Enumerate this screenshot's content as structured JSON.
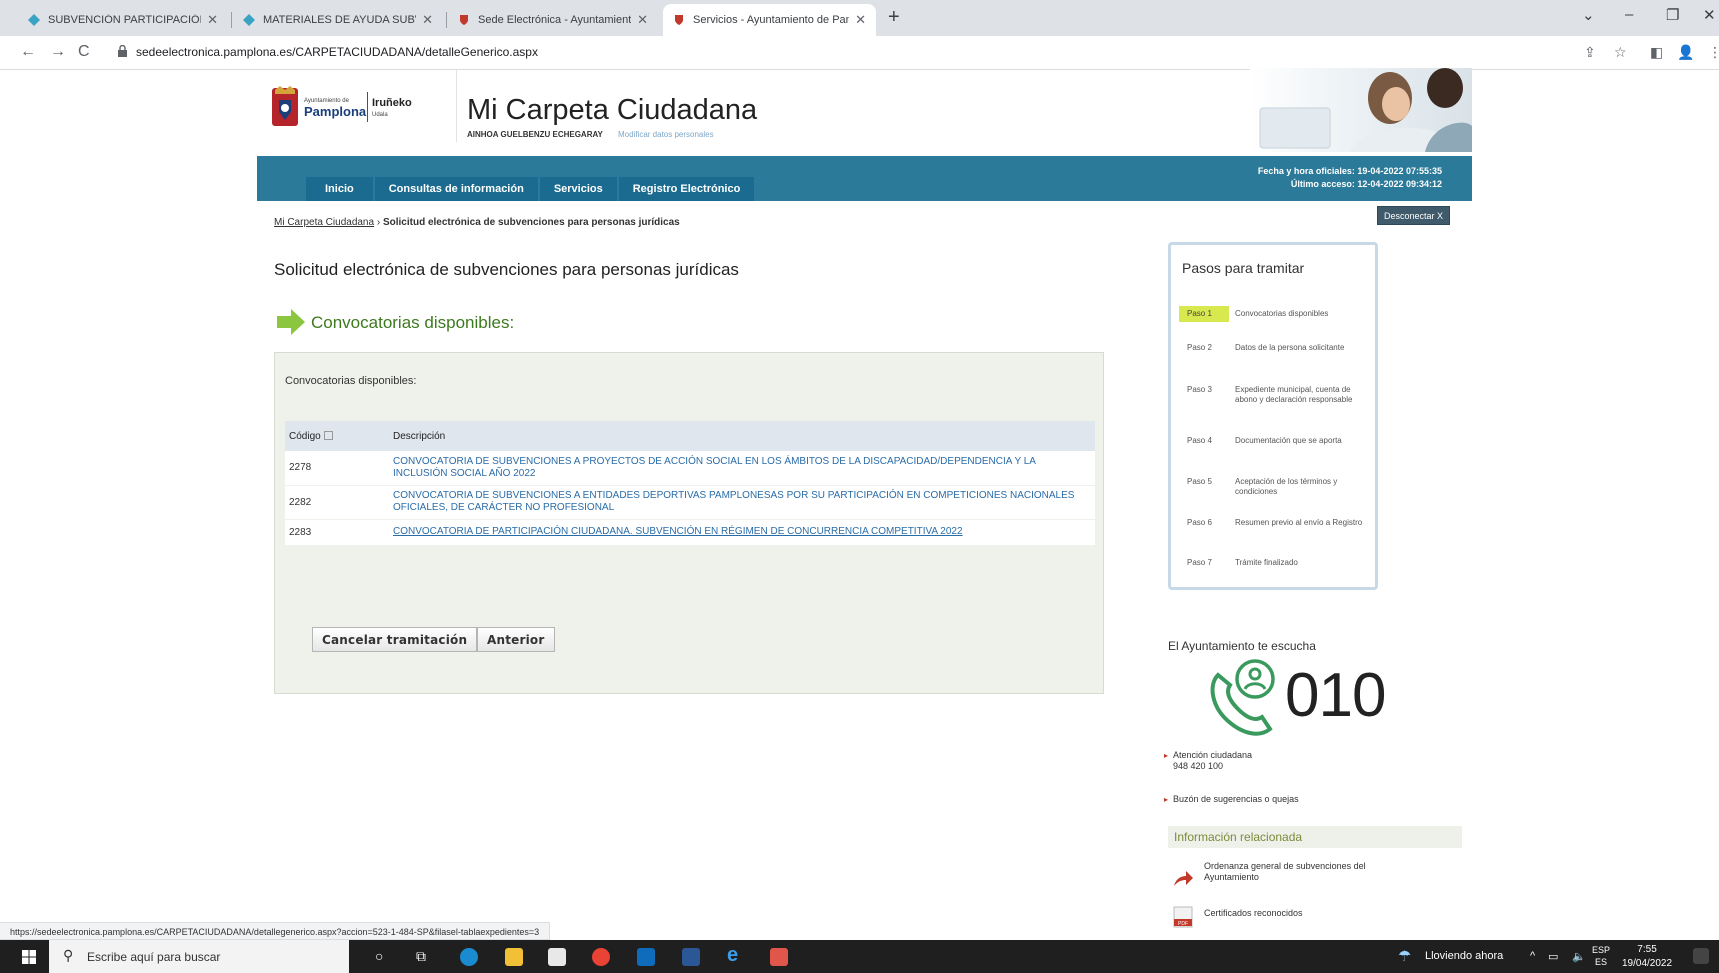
{
  "browser": {
    "tabs": [
      {
        "title": "SUBVENCIÓN PARTICIPACIÓN CI",
        "active": false
      },
      {
        "title": "MATERIALES DE AYUDA SUBVEN",
        "active": false
      },
      {
        "title": "Sede Electrónica - Ayuntamiento",
        "active": false
      },
      {
        "title": "Servicios - Ayuntamiento de Pam",
        "active": true
      }
    ],
    "url": "sedeelectronica.pamplona.es/CARPETACIUDADANA/detalleGenerico.aspx",
    "status_url": "https://sedeelectronica.pamplona.es/CARPETACIUDADANA/detallegenerico.aspx?accion=523-1-484-SP&filasel-tablaexpedientes=3"
  },
  "header": {
    "logo_line1": "Ayuntamiento de",
    "logo_line2": "Pamplona",
    "logo_line3": "Iruñeko",
    "logo_line4": "Udala",
    "site_title": "Mi Carpeta Ciudadana",
    "user_name": "AINHOA GUELBENZU ECHEGARAY",
    "modify_link": "Modificar datos personales"
  },
  "nav": {
    "items": [
      "Inicio",
      "Consultas de información",
      "Servicios",
      "Registro Electrónico"
    ],
    "official_label": "Fecha y hora oficiales:",
    "official_value": "19-04-2022 07:55:35",
    "last_label": "Último acceso:",
    "last_value": "12-04-2022 09:34:12",
    "disconnect": "Desconectar X"
  },
  "breadcrumb": {
    "root": "Mi Carpeta Ciudadana",
    "sep": " › ",
    "current": "Solicitud electrónica de subvenciones para personas jurídicas"
  },
  "main": {
    "page_title": "Solicitud electrónica de subvenciones para personas jurídicas",
    "section_title": "Convocatorias disponibles:",
    "panel_label": "Convocatorias disponibles:",
    "columns": [
      "Código",
      "Descripción"
    ],
    "rows": [
      {
        "code": "2278",
        "desc": "CONVOCATORIA DE SUBVENCIONES A PROYECTOS DE ACCIÓN SOCIAL EN LOS ÁMBITOS DE LA DISCAPACIDAD/DEPENDENCIA Y LA INCLUSIÓN SOCIAL AÑO 2022"
      },
      {
        "code": "2282",
        "desc": "CONVOCATORIA DE SUBVENCIONES A ENTIDADES DEPORTIVAS PAMPLONESAS POR SU PARTICIPACIÓN EN COMPETICIONES NACIONALES OFICIALES, DE CARÁCTER NO PROFESIONAL"
      },
      {
        "code": "2283",
        "desc": "CONVOCATORIA DE PARTICIPACIÓN CIUDADANA. SUBVENCIÓN EN RÉGIMEN DE CONCURRENCIA COMPETITIVA 2022"
      }
    ],
    "cancel_button": "Cancelar tramitación",
    "back_button": "Anterior"
  },
  "steps": {
    "title": "Pasos para tramitar",
    "items": [
      {
        "num": "Paso 1",
        "label": "Convocatorias disponibles",
        "active": true
      },
      {
        "num": "Paso 2",
        "label": "Datos de la persona solicitante",
        "active": false
      },
      {
        "num": "Paso 3",
        "label": "Expediente municipal, cuenta de abono y declaración responsable",
        "active": false
      },
      {
        "num": "Paso 4",
        "label": "Documentación que se aporta",
        "active": false
      },
      {
        "num": "Paso 5",
        "label": "Aceptación de los términos y condiciones",
        "active": false
      },
      {
        "num": "Paso 6",
        "label": "Resumen previo al envío a Registro",
        "active": false
      },
      {
        "num": "Paso 7",
        "label": "Trámite finalizado",
        "active": false
      }
    ]
  },
  "contact": {
    "title": "El Ayuntamiento te escucha",
    "phone": "010",
    "attention_label": "Atención ciudadana",
    "attention_phone": "948 420 100",
    "suggestions": "Buzón de sugerencias o quejas"
  },
  "related": {
    "title": "Información relacionada",
    "items": [
      "Ordenanza general de subvenciones del Ayuntamiento",
      "Certificados reconocidos"
    ]
  },
  "taskbar": {
    "search_placeholder": "Escribe aquí para buscar",
    "weather": "Lloviendo ahora",
    "lang1": "ESP",
    "lang2": "ES",
    "time": "7:55",
    "date": "19/04/2022"
  },
  "colors": {
    "nav_bar": "#2c7a99",
    "nav_tab": "#1a6b8f",
    "section_green": "#3d7a1e",
    "link_blue": "#2a6ca8",
    "step_active": "#d7e94e"
  }
}
